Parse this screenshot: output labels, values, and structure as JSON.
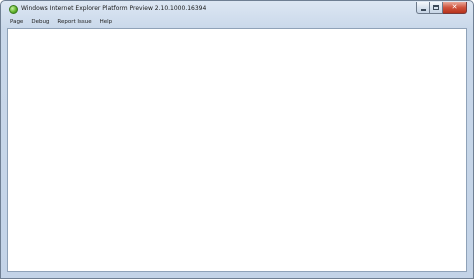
{
  "window": {
    "title": "Windows Internet Explorer Platform Preview 2.10.1000.16394",
    "icon": "ie-preview-icon",
    "caption_buttons": {
      "minimize": "minimize-icon",
      "maximize": "maximize-icon",
      "close": "close-icon",
      "close_glyph": "✕"
    }
  },
  "menu": {
    "items": [
      {
        "label": "Page"
      },
      {
        "label": "Debug"
      },
      {
        "label": "Report Issue"
      },
      {
        "label": "Help"
      }
    ]
  },
  "colors": {
    "frame": "#c3d3e7",
    "close_button": "#d0533d",
    "content_background": "#ffffff"
  }
}
